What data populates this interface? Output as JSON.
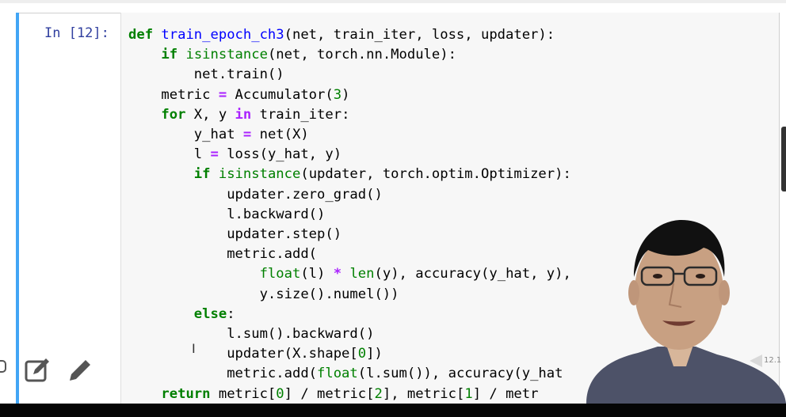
{
  "cell": {
    "prompt": "In [12]:",
    "code": {
      "line1_kw": "def",
      "line1_fn": "train_epoch_ch3",
      "line1_rest": "(net, train_iter, loss, updater):",
      "line2_kw": "if",
      "line2_bi": "isinstance",
      "line2_rest": "(net, torch.nn.Module):",
      "line3": "net.train()",
      "line4_a": "metric ",
      "line4_op": "=",
      "line4_b": " Accumulator(",
      "line4_num": "3",
      "line4_c": ")",
      "line5_kw": "for",
      "line5_a": " X, y ",
      "line5_op": "in",
      "line5_b": " train_iter:",
      "line6_a": "y_hat ",
      "line6_op": "=",
      "line6_b": " net(X)",
      "line7_a": "l ",
      "line7_op": "=",
      "line7_b": " loss(y_hat, y)",
      "line8_kw": "if",
      "line8_bi": "isinstance",
      "line8_rest": "(updater, torch.optim.Optimizer):",
      "line9": "updater.zero_grad()",
      "line10": "l.backward()",
      "line11": "updater.step()",
      "line12": "metric.add(",
      "line13_bi1": "float",
      "line13_a": "(l) ",
      "line13_op": "*",
      "line13_bi2": "len",
      "line13_b": "(y), accuracy(y_hat, y),",
      "line14": "y.size().numel())",
      "line15_kw": "else",
      "line15_a": ":",
      "line16": "l.sum().backward()",
      "line17_a": "updater(X.shape[",
      "line17_num": "0",
      "line17_b": "])",
      "line18_a": "metric.add(",
      "line18_bi": "float",
      "line18_b": "(l.sum()), accuracy(y_hat",
      "line19_kw": "return",
      "line19_a": " metric[",
      "line19_n1": "0",
      "line19_b": "] / metric[",
      "line19_n2": "2",
      "line19_c": "], metric[",
      "line19_n3": "1",
      "line19_d": "] / metr"
    }
  },
  "toolbar": {
    "icons": [
      "edit-note-icon",
      "pencil-icon"
    ]
  },
  "slide_badge": "12.1",
  "colors": {
    "keyword": "#008000",
    "function_name": "#0000ff",
    "operator": "#aa22ff",
    "prompt": "#303f9f"
  }
}
